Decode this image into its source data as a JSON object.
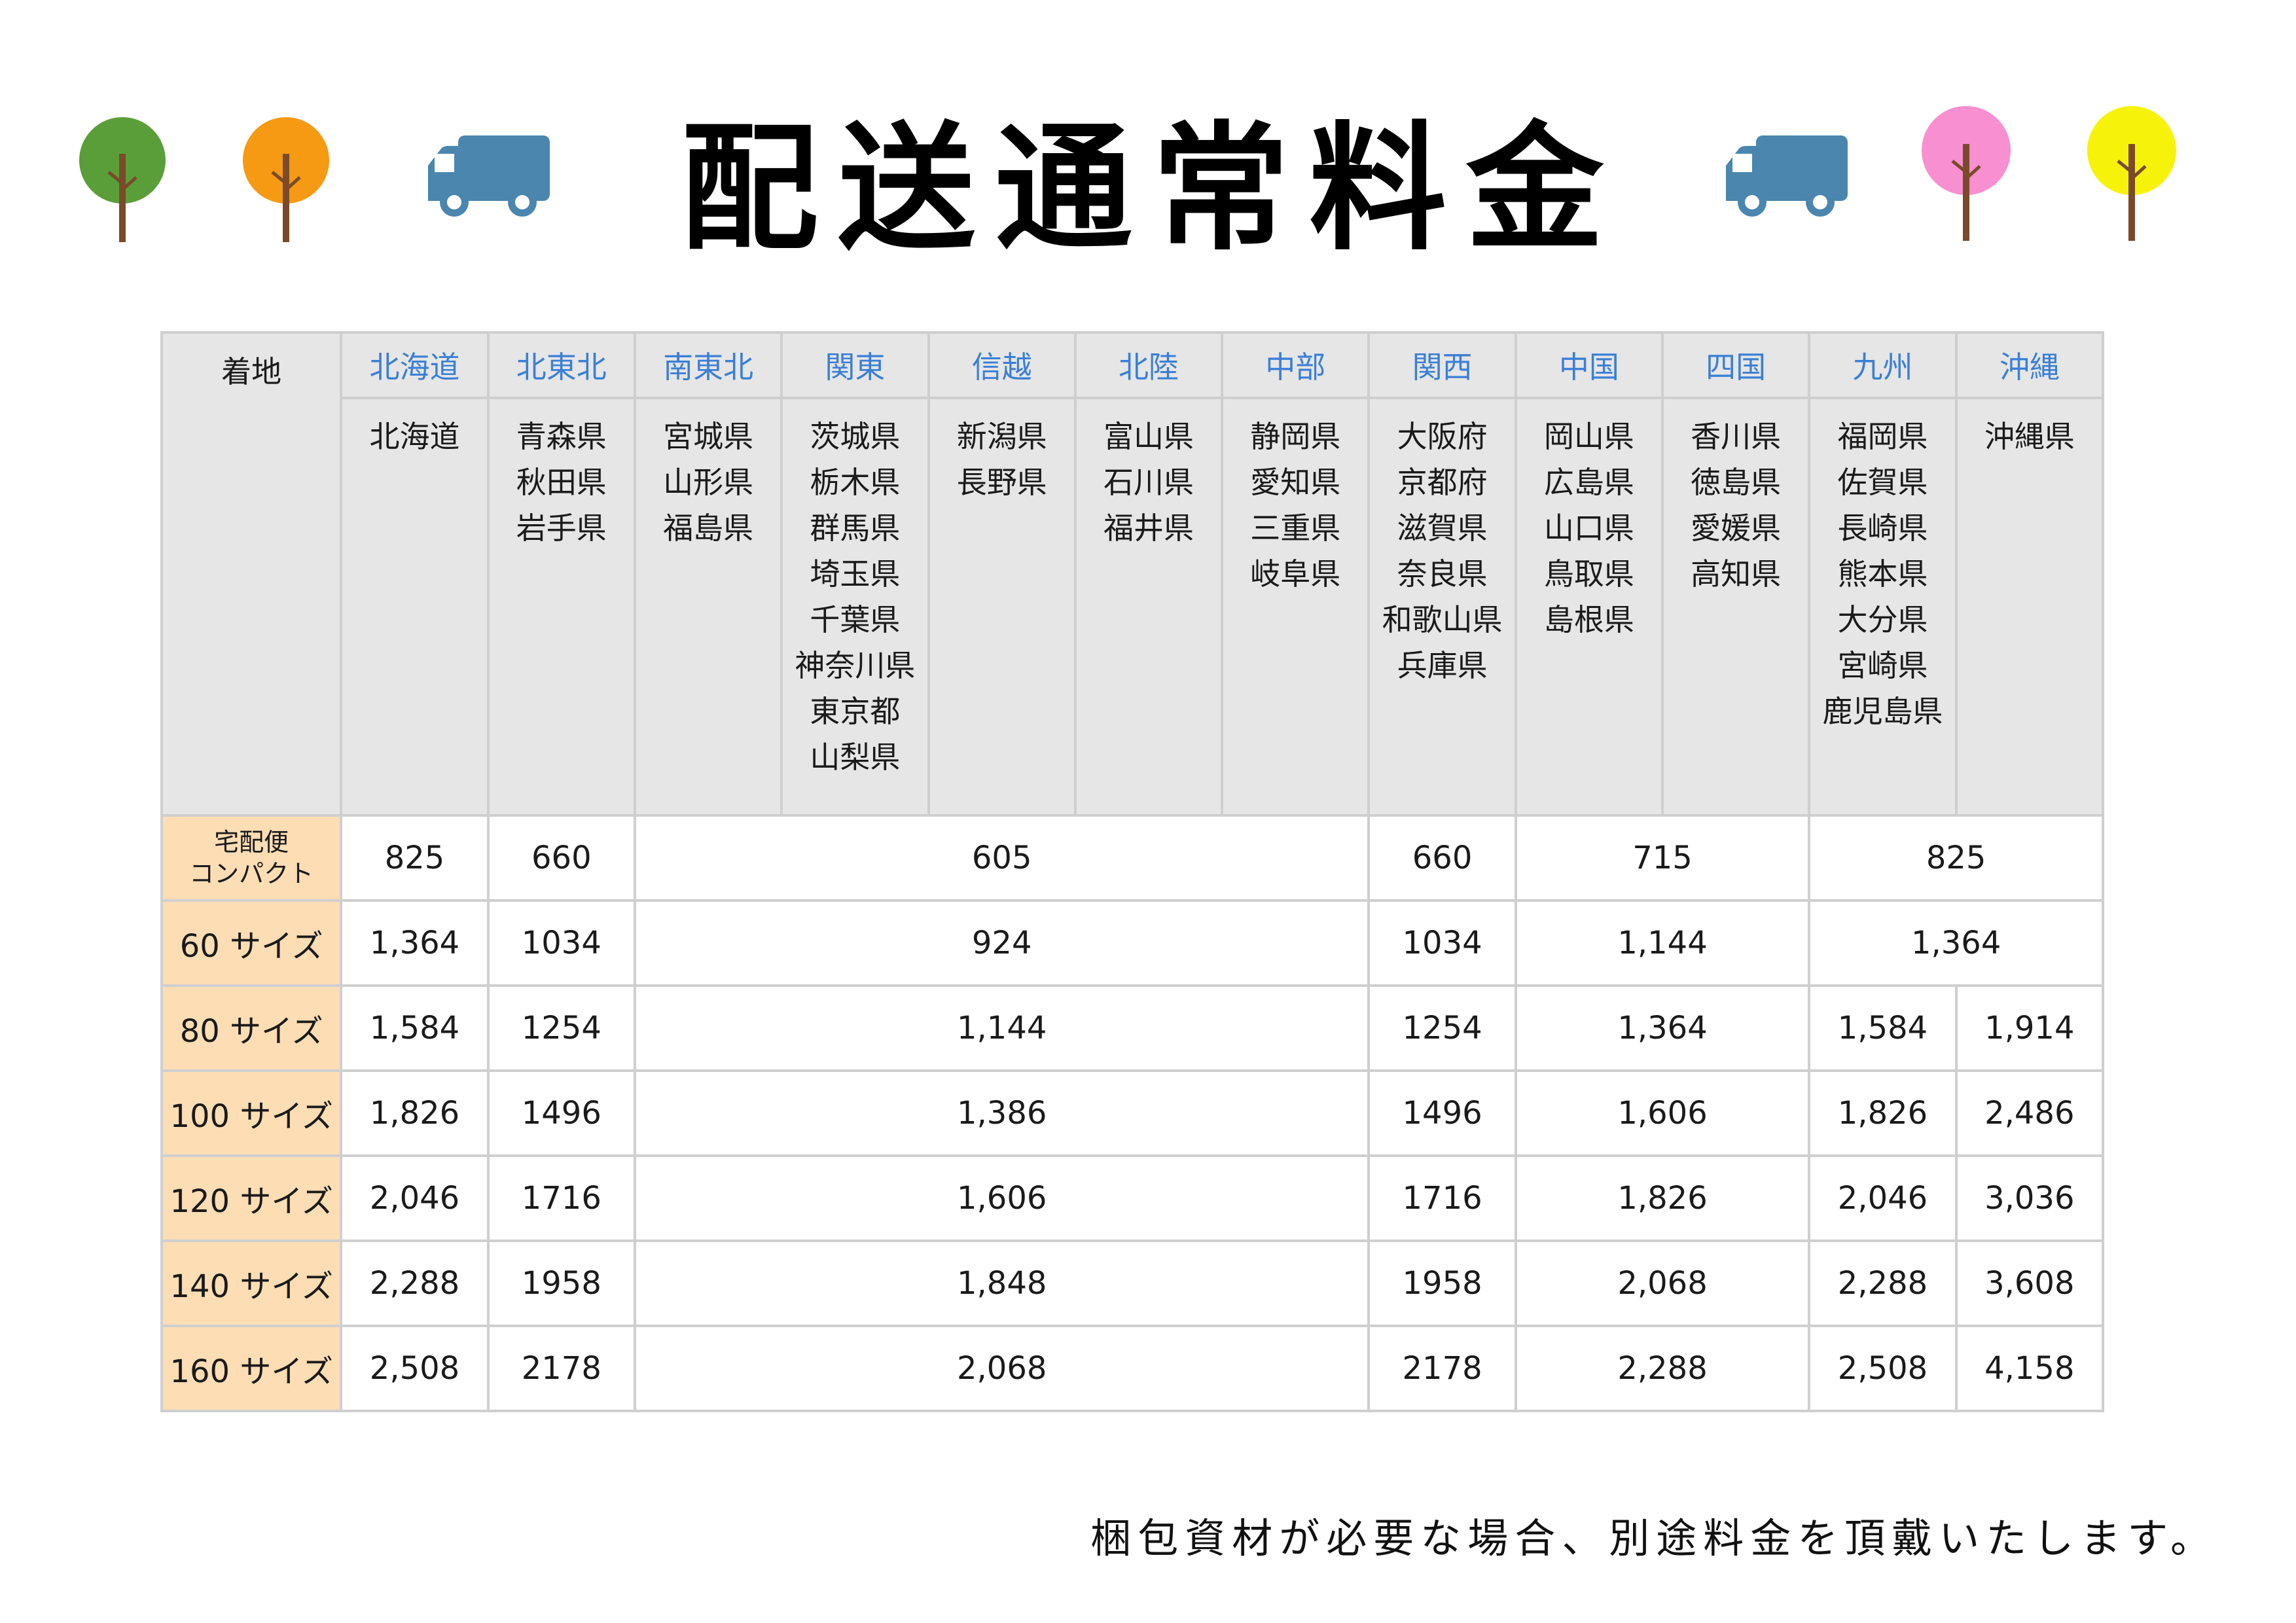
{
  "title": "配送通常料金",
  "icons": {
    "trees": [
      "tree-icon-green",
      "tree-icon-orange",
      "tree-icon-pink",
      "tree-icon-yellow"
    ],
    "truck": "truck-icon"
  },
  "colors": {
    "tree_green": "#5a9e3a",
    "tree_orange": "#f59a12",
    "tree_pink": "#f78fd0",
    "tree_yellow": "#f7f20a",
    "trunk": "#7a4a2a",
    "truck": "#4a86ae",
    "header_bg": "#e6e6e6",
    "row_label_bg": "#fdddb4",
    "region_text": "#3a7fd6"
  },
  "table": {
    "corner_label": "着地",
    "regions": [
      {
        "name": "北海道",
        "prefectures": [
          "北海道"
        ]
      },
      {
        "name": "北東北",
        "prefectures": [
          "青森県",
          "秋田県",
          "岩手県"
        ]
      },
      {
        "name": "南東北",
        "prefectures": [
          "宮城県",
          "山形県",
          "福島県"
        ]
      },
      {
        "name": "関東",
        "prefectures": [
          "茨城県",
          "栃木県",
          "群馬県",
          "埼玉県",
          "千葉県",
          "神奈川県",
          "東京都",
          "山梨県"
        ]
      },
      {
        "name": "信越",
        "prefectures": [
          "新潟県",
          "長野県"
        ]
      },
      {
        "name": "北陸",
        "prefectures": [
          "富山県",
          "石川県",
          "福井県"
        ]
      },
      {
        "name": "中部",
        "prefectures": [
          "静岡県",
          "愛知県",
          "三重県",
          "岐阜県"
        ]
      },
      {
        "name": "関西",
        "prefectures": [
          "大阪府",
          "京都府",
          "滋賀県",
          "奈良県",
          "和歌山県",
          "兵庫県"
        ]
      },
      {
        "name": "中国",
        "prefectures": [
          "岡山県",
          "広島県",
          "山口県",
          "鳥取県",
          "島根県"
        ]
      },
      {
        "name": "四国",
        "prefectures": [
          "香川県",
          "徳島県",
          "愛媛県",
          "高知県"
        ]
      },
      {
        "name": "九州",
        "prefectures": [
          "福岡県",
          "佐賀県",
          "長崎県",
          "熊本県",
          "大分県",
          "宮崎県",
          "鹿児島県"
        ]
      },
      {
        "name": "沖縄",
        "prefectures": [
          "沖縄県"
        ]
      }
    ],
    "rows": [
      {
        "label_lines": [
          "宅配便",
          "コンパクト"
        ],
        "hokkaido": "825",
        "kitatohoku": "660",
        "kanto_chubu": "605",
        "kansai": "660",
        "chugoku_shikoku": "715",
        "kyushu_okinawa": "825"
      },
      {
        "label": "60 サイズ",
        "hokkaido": "1,364",
        "kitatohoku": "1034",
        "kanto_chubu": "924",
        "kansai": "1034",
        "chugoku_shikoku": "1,144",
        "kyushu_okinawa": "1,364"
      },
      {
        "label": "80 サイズ",
        "hokkaido": "1,584",
        "kitatohoku": "1254",
        "kanto_chubu": "1,144",
        "kansai": "1254",
        "chugoku_shikoku": "1,364",
        "kyushu": "1,584",
        "okinawa": "1,914"
      },
      {
        "label": "100 サイズ",
        "hokkaido": "1,826",
        "kitatohoku": "1496",
        "kanto_chubu": "1,386",
        "kansai": "1496",
        "chugoku_shikoku": "1,606",
        "kyushu": "1,826",
        "okinawa": "2,486"
      },
      {
        "label": "120 サイズ",
        "hokkaido": "2,046",
        "kitatohoku": "1716",
        "kanto_chubu": "1,606",
        "kansai": "1716",
        "chugoku_shikoku": "1,826",
        "kyushu": "2,046",
        "okinawa": "3,036"
      },
      {
        "label": "140 サイズ",
        "hokkaido": "2,288",
        "kitatohoku": "1958",
        "kanto_chubu": "1,848",
        "kansai": "1958",
        "chugoku_shikoku": "2,068",
        "kyushu": "2,288",
        "okinawa": "3,608"
      },
      {
        "label": "160 サイズ",
        "hokkaido": "2,508",
        "kitatohoku": "2178",
        "kanto_chubu": "2,068",
        "kansai": "2178",
        "chugoku_shikoku": "2,288",
        "kyushu": "2,508",
        "okinawa": "4,158"
      }
    ]
  },
  "note": "梱包資材が必要な場合、別途料金を頂戴いたします。"
}
